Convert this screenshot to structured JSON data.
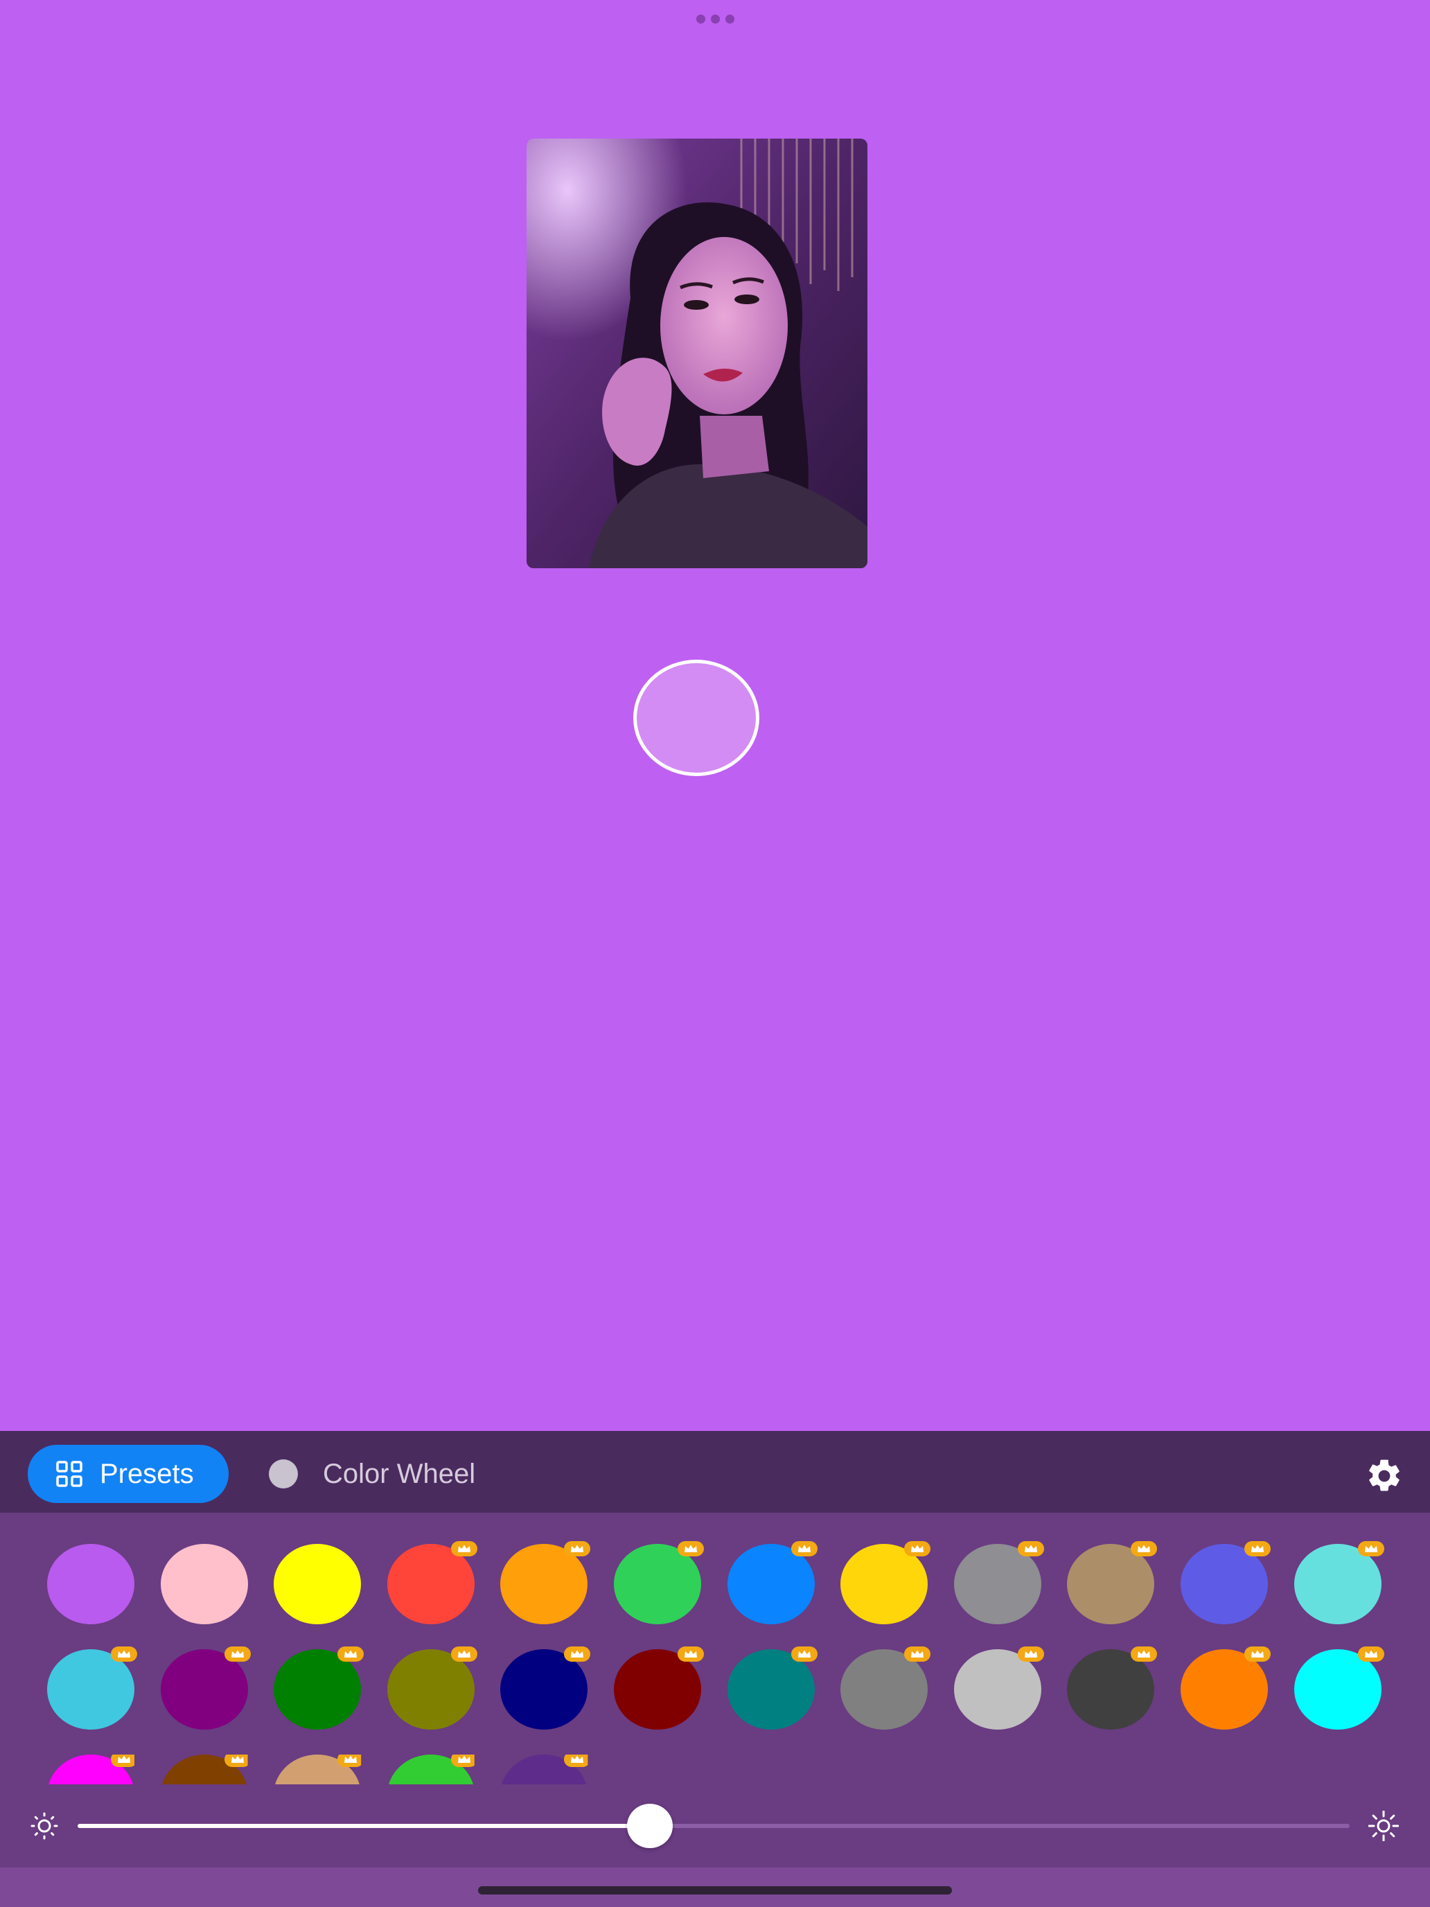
{
  "tabs": {
    "presets_label": "Presets",
    "color_wheel_label": "Color Wheel",
    "active": "presets"
  },
  "icons": {
    "more": "more-dots-icon",
    "presets": "grid-icon",
    "color_wheel": "color-wheel-dot-icon",
    "settings": "gear-icon",
    "brightness_low": "sun-low-icon",
    "brightness_high": "sun-high-icon",
    "premium": "crown-icon"
  },
  "colors": {
    "background": "#BE60F2",
    "selected_preview": "#D38CF4",
    "accent": "#1283F5",
    "premium_badge": "#F3A814"
  },
  "brightness": {
    "value": 0.45
  },
  "swatches": [
    {
      "color": "#B85BEE",
      "premium": false
    },
    {
      "color": "#FFC0CB",
      "premium": false
    },
    {
      "color": "#FFFF00",
      "premium": false
    },
    {
      "color": "#FF453A",
      "premium": true
    },
    {
      "color": "#FF9F0A",
      "premium": true
    },
    {
      "color": "#30D158",
      "premium": true
    },
    {
      "color": "#0A84FF",
      "premium": true
    },
    {
      "color": "#FFD60A",
      "premium": true
    },
    {
      "color": "#8E8E93",
      "premium": true
    },
    {
      "color": "#AC8E68",
      "premium": true
    },
    {
      "color": "#5E5CE6",
      "premium": true
    },
    {
      "color": "#66E0DF",
      "premium": true
    },
    {
      "color": "#40C8E0",
      "premium": true
    },
    {
      "color": "#800080",
      "premium": true
    },
    {
      "color": "#008000",
      "premium": true
    },
    {
      "color": "#808000",
      "premium": true
    },
    {
      "color": "#000080",
      "premium": true
    },
    {
      "color": "#800000",
      "premium": true
    },
    {
      "color": "#008080",
      "premium": true
    },
    {
      "color": "#808080",
      "premium": true
    },
    {
      "color": "#C0C0C0",
      "premium": true
    },
    {
      "color": "#404040",
      "premium": true
    },
    {
      "color": "#FF8000",
      "premium": true
    },
    {
      "color": "#00FFFF",
      "premium": true
    },
    {
      "color": "#FF00FF",
      "premium": true
    },
    {
      "color": "#804000",
      "premium": true
    },
    {
      "color": "#D2A070",
      "premium": true
    },
    {
      "color": "#32CD32",
      "premium": true
    },
    {
      "color": "#5E2C8A",
      "premium": true
    }
  ]
}
